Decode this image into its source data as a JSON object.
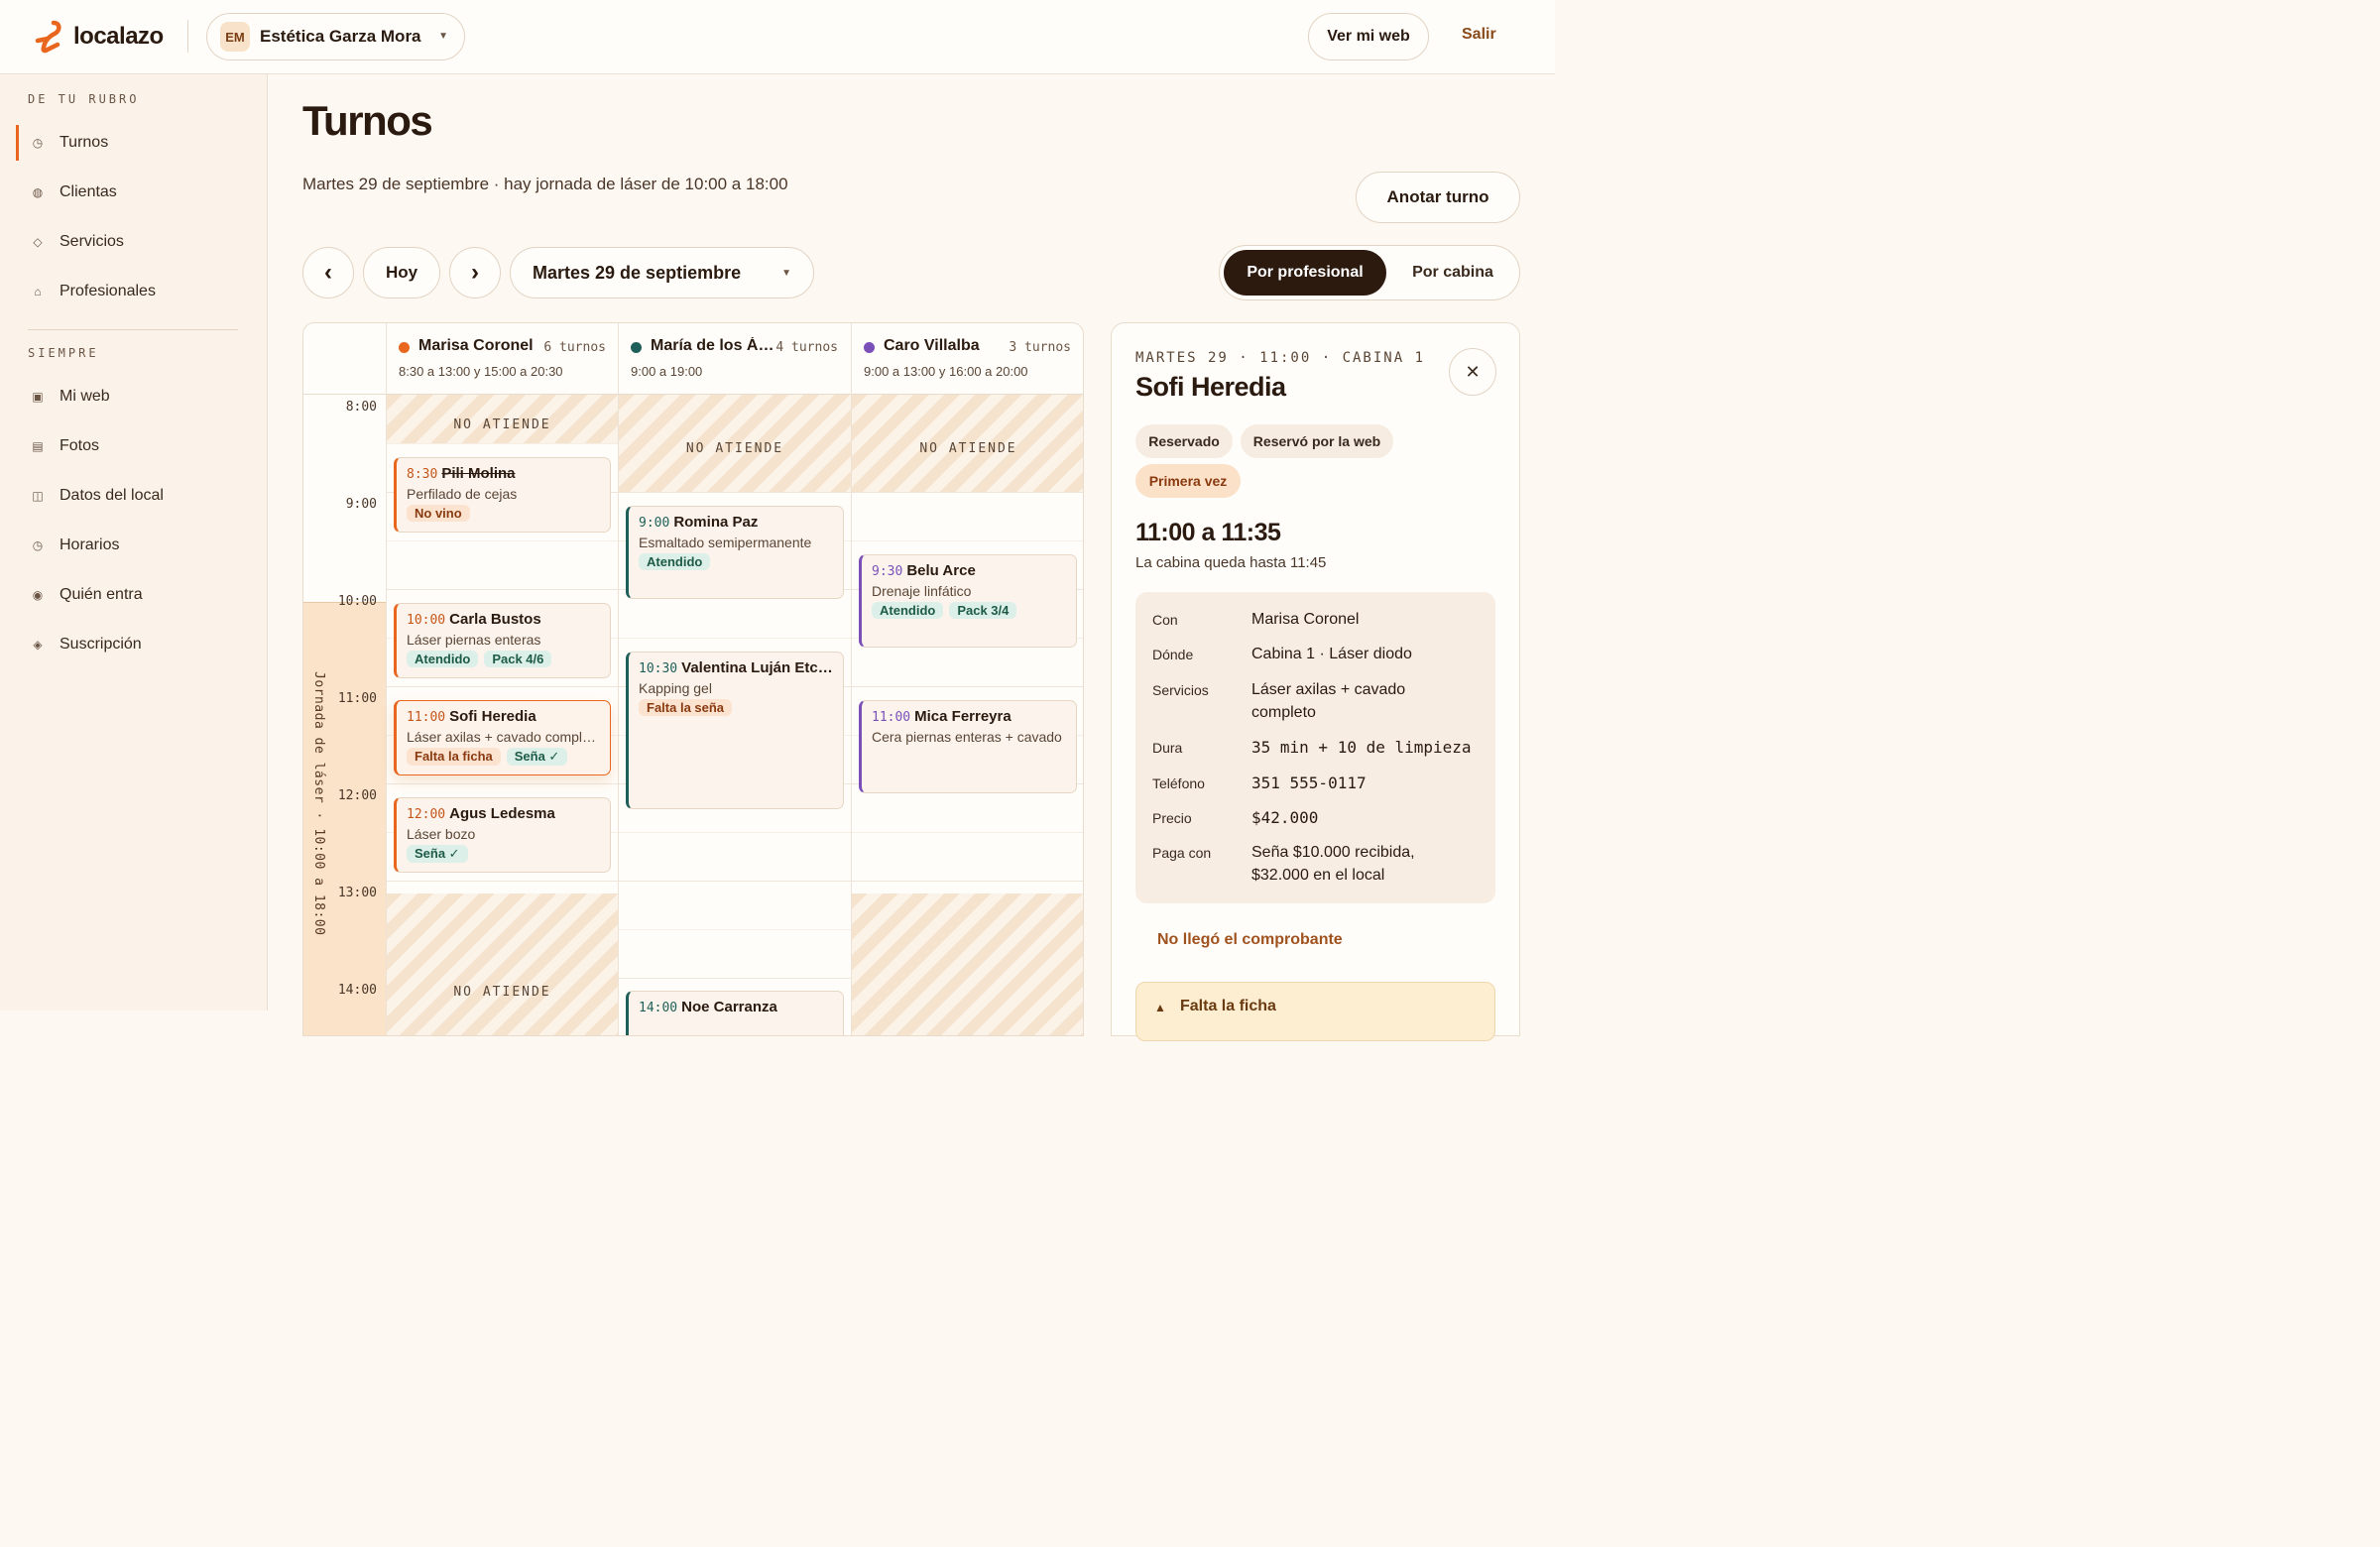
{
  "brand": {
    "name": "localazo",
    "accent": "#e8661e"
  },
  "business": {
    "initials": "EM",
    "name": "Estética Garza Mora"
  },
  "header": {
    "web_btn": "Ver mi web",
    "logout": "Salir"
  },
  "sidebar": {
    "section1": "DE TU RUBRO",
    "section2": "SIEMPRE",
    "items1": [
      {
        "label": "Turnos",
        "icon": "clock-icon",
        "glyph": "◷"
      },
      {
        "label": "Clientas",
        "icon": "people-icon",
        "glyph": "◍"
      },
      {
        "label": "Servicios",
        "icon": "diamond-icon",
        "glyph": "◇"
      },
      {
        "label": "Profesionales",
        "icon": "person-icon",
        "glyph": "⌂"
      }
    ],
    "items2": [
      {
        "label": "Mi web",
        "icon": "web-icon",
        "glyph": "▣"
      },
      {
        "label": "Fotos",
        "icon": "photos-icon",
        "glyph": "▤"
      },
      {
        "label": "Datos del local",
        "icon": "store-icon",
        "glyph": "◫"
      },
      {
        "label": "Horarios",
        "icon": "hours-icon",
        "glyph": "◷"
      },
      {
        "label": "Quién entra",
        "icon": "access-icon",
        "glyph": "◉"
      },
      {
        "label": "Suscripción",
        "icon": "subscription-icon",
        "glyph": "◈"
      }
    ]
  },
  "page": {
    "title": "Turnos",
    "subtitle": "Martes 29 de septiembre · hay jornada de láser de 10:00 a 18:00",
    "add_btn": "Anotar turno",
    "prev_glyph": "‹",
    "next_glyph": "›",
    "today_btn": "Hoy",
    "date_value": "Martes 29 de septiembre",
    "view_active": "Por profesional",
    "view_other": "Por cabina"
  },
  "calendar": {
    "laser_label": "Jornada de láser · 10:00 a 18:00",
    "blocked_label": "NO ATIENDE",
    "hours": [
      "8:00",
      "9:00",
      "10:00",
      "11:00",
      "12:00",
      "13:00",
      "14:00"
    ],
    "columns": [
      {
        "name": "Marisa Coronel",
        "count": "6 turnos",
        "hours": "8:30 a 13:00 y 15:00 a 20:30",
        "color": "#e8661e"
      },
      {
        "name": "María de los Ángeles",
        "count": "4 turnos",
        "hours": "9:00 a 19:00",
        "color": "#1f5f5a"
      },
      {
        "name": "Caro Villalba",
        "count": "3 turnos",
        "hours": "9:00 a 13:00 y 16:00 a 20:00",
        "color": "#7a4fb8"
      }
    ],
    "appointments": [
      {
        "time": "8:30",
        "name": "Pili Molina",
        "service": "Perfilado de cejas",
        "tags": [
          {
            "t": "No vino",
            "k": "peach"
          }
        ]
      },
      {
        "time": "10:00",
        "name": "Carla Bustos",
        "service": "Láser piernas enteras",
        "tags": [
          {
            "t": "Atendido",
            "k": "green"
          },
          {
            "t": "Pack 4/6",
            "k": "green"
          }
        ]
      },
      {
        "time": "11:00",
        "name": "Sofi Heredia",
        "service": "Láser axilas + cavado completo",
        "tags": [
          {
            "t": "Falta la ficha",
            "k": "peach"
          },
          {
            "t": "Seña ✓",
            "k": "green"
          }
        ]
      },
      {
        "time": "12:00",
        "name": "Agus Ledesma",
        "service": "Láser bozo",
        "tags": [
          {
            "t": "Seña ✓",
            "k": "green"
          }
        ]
      },
      {
        "time": "9:00",
        "name": "Romina Paz",
        "service": "Esmaltado semipermanente",
        "tags": [
          {
            "t": "Atendido",
            "k": "green"
          }
        ]
      },
      {
        "time": "10:30",
        "name": "Valentina Luján Etcheverry",
        "service": "Kapping gel",
        "tags": [
          {
            "t": "Falta la seña",
            "k": "peach"
          }
        ]
      },
      {
        "time": "14:00",
        "name": "Noe Carranza",
        "service": "",
        "tags": []
      },
      {
        "time": "9:30",
        "name": "Belu Arce",
        "service": "Drenaje linfático",
        "tags": [
          {
            "t": "Atendido",
            "k": "green"
          },
          {
            "t": "Pack 3/4",
            "k": "green"
          }
        ]
      },
      {
        "time": "11:00",
        "name": "Mica Ferreyra",
        "service": "Cera piernas enteras + cavado",
        "tags": []
      }
    ]
  },
  "detail": {
    "eyebrow": "MARTES 29 · 11:00 · CABINA 1",
    "name": "Sofi Heredia",
    "close_glyph": "✕",
    "chips": [
      "Reservado",
      "Reservó por la web",
      "Primera vez"
    ],
    "range": "11:00 a 11:35",
    "note": "La cabina queda hasta 11:45",
    "rows": [
      {
        "k": "Con",
        "v": "Marisa Coronel"
      },
      {
        "k": "Dónde",
        "v": "Cabina 1 · Láser diodo"
      },
      {
        "k": "Servicios",
        "v": "Láser axilas + cavado completo"
      },
      {
        "k": "Dura",
        "v": "35 min + 10 de limpieza"
      },
      {
        "k": "Teléfono",
        "v": "351 555-0117"
      },
      {
        "k": "Precio",
        "v": "$42.000"
      },
      {
        "k": "Paga con",
        "v": "Seña $10.000 recibida, $32.000 en el local"
      }
    ],
    "link": "No llegó el comprobante",
    "warning": "Falta la ficha",
    "warning_glyph": "▲"
  }
}
